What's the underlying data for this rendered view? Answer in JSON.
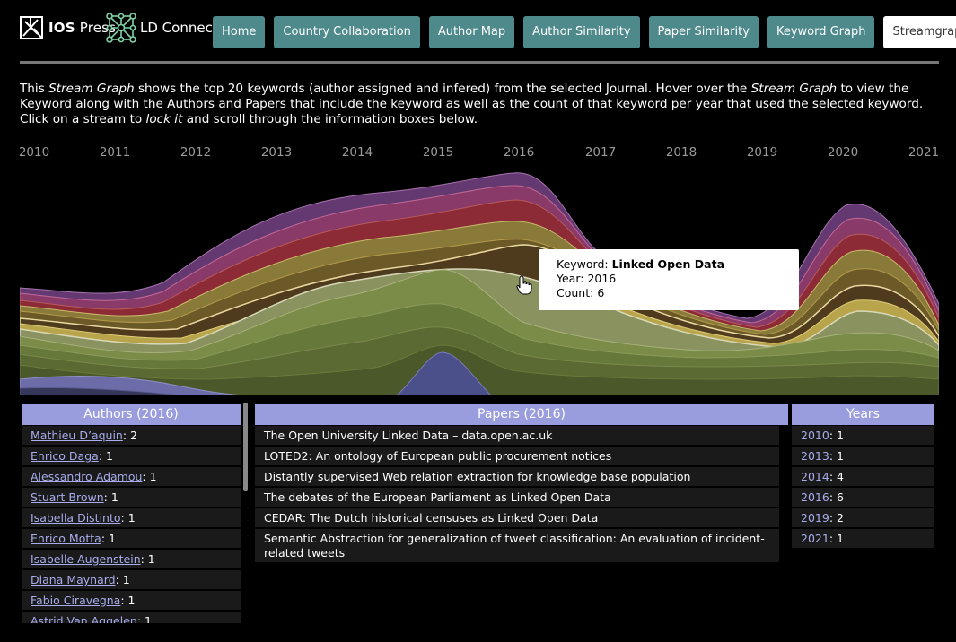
{
  "brand": {
    "ios_prefix": "IOS",
    "ios_suffix": "Press",
    "ld_name": "LD Connect"
  },
  "nav": {
    "items": [
      "Home",
      "Country Collaboration",
      "Author Map",
      "Author Similarity",
      "Paper Similarity",
      "Keyword Graph",
      "Streamgraph"
    ],
    "active": "Streamgraph"
  },
  "intro": {
    "p1": "This ",
    "em1": "Stream Graph",
    "p2": " shows the top 20 keywords (author assigned and infered) from the selected Journal. Hover over the ",
    "em2": "Stream Graph",
    "p3": " to view the Keyword along with the Authors and Papers that include the keyword as well as the count of that keyword per year that used the selected keyword. Click on a stream to ",
    "em3": "lock it",
    "p4": " and scroll through the information boxes below."
  },
  "years_axis": [
    "2010",
    "2011",
    "2012",
    "2013",
    "2014",
    "2015",
    "2016",
    "2017",
    "2018",
    "2019",
    "2020",
    "2021"
  ],
  "tooltip": {
    "keyword_label": "Keyword: ",
    "keyword": "Linked Open Data",
    "year_label": "Year: ",
    "year": "2016",
    "count_label": "Count: ",
    "count": "6"
  },
  "authors_panel": {
    "title": "Authors (2016)",
    "rows": [
      {
        "name": "Mathieu D’aquin",
        "count": ": 2"
      },
      {
        "name": "Enrico Daga",
        "count": ": 1"
      },
      {
        "name": "Alessandro Adamou",
        "count": ": 1"
      },
      {
        "name": "Stuart Brown",
        "count": ": 1"
      },
      {
        "name": "Isabella Distinto",
        "count": ": 1"
      },
      {
        "name": "Enrico Motta",
        "count": ": 1"
      },
      {
        "name": "Isabelle Augenstein",
        "count": ": 1"
      },
      {
        "name": "Diana Maynard",
        "count": ": 1"
      },
      {
        "name": "Fabio Ciravegna",
        "count": ": 1"
      },
      {
        "name": "Astrid Van Aggelen",
        "count": ": 1"
      }
    ]
  },
  "papers_panel": {
    "title": "Papers (2016)",
    "rows": [
      "The Open University Linked Data – data.open.ac.uk",
      "LOTED2: An ontology of European public procurement notices",
      "Distantly supervised Web relation extraction for knowledge base population",
      "The debates of the European Parliament as Linked Open Data",
      "CEDAR: The Dutch historical censuses as Linked Open Data",
      "Semantic Abstraction for generalization of tweet classification: An evaluation of incident-related tweets"
    ]
  },
  "years_panel": {
    "title": "Years",
    "rows": [
      {
        "year": "2010",
        "count": ": 1"
      },
      {
        "year": "2013",
        "count": ": 1"
      },
      {
        "year": "2014",
        "count": ": 4"
      },
      {
        "year": "2016",
        "count": ": 6"
      },
      {
        "year": "2019",
        "count": ": 2"
      },
      {
        "year": "2021",
        "count": ": 1"
      }
    ]
  },
  "colors": {
    "nav_button": "#4e8a8c",
    "panel_header": "#9a9ddd",
    "link": "#a8acec",
    "stream_palette": [
      "#4b4f8a",
      "#5d6a38",
      "#6f7d3c",
      "#8a9a5a",
      "#a7ad86",
      "#b99a3c",
      "#7a6a2a",
      "#a54a4a",
      "#9a3c6c",
      "#7a3b7a"
    ]
  }
}
